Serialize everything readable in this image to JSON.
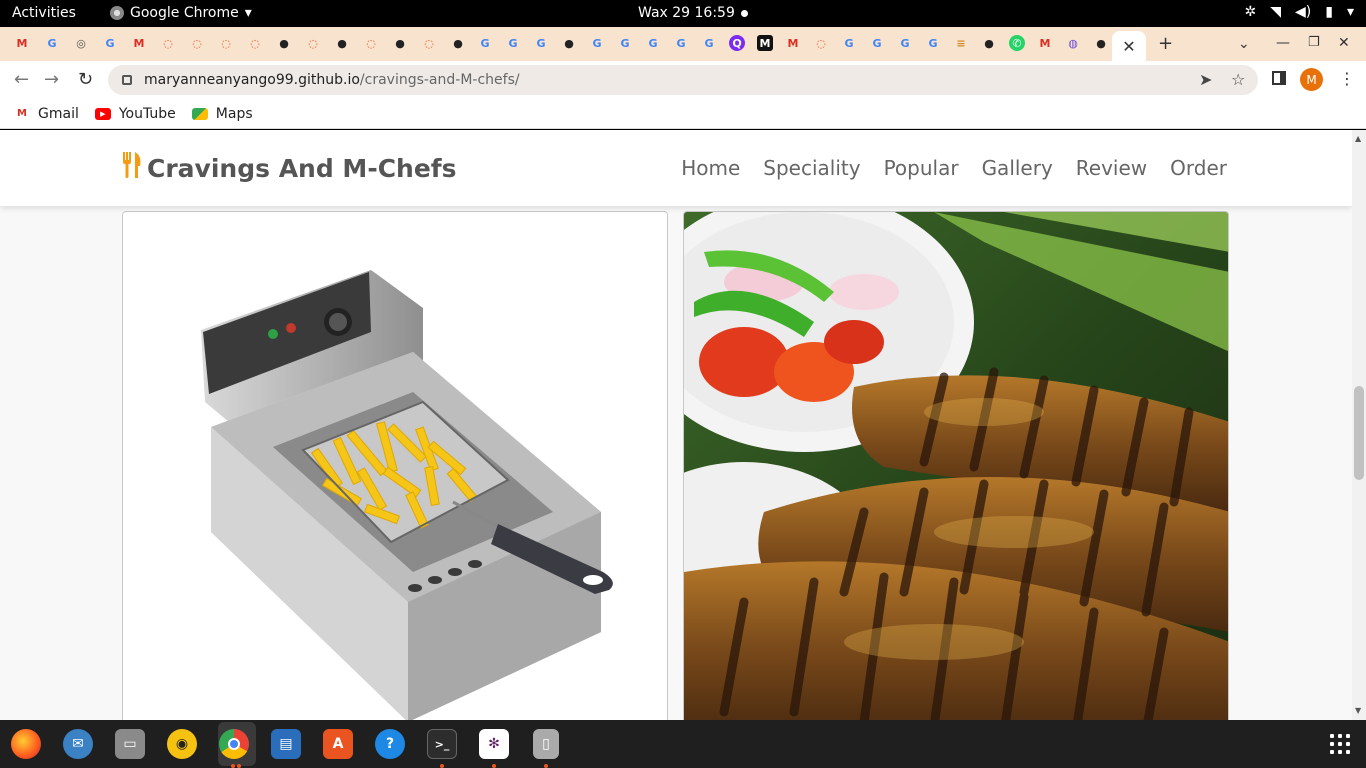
{
  "system_bar": {
    "activities": "Activities",
    "app_name": "Google Chrome",
    "clock": "Wax 29  16:59"
  },
  "browser": {
    "url_host": "maryanneanyango99.github.io",
    "url_path": "/cravings-and-M-chefs/",
    "avatar_initial": "M",
    "bookmarks": [
      {
        "label": "Gmail",
        "icon": "gmail-icon"
      },
      {
        "label": "YouTube",
        "icon": "youtube-icon"
      },
      {
        "label": "Maps",
        "icon": "maps-icon"
      }
    ]
  },
  "site": {
    "logo_text": "Cravings And M-Chefs",
    "nav": [
      "Home",
      "Speciality",
      "Popular",
      "Gallery",
      "Review",
      "Order"
    ]
  },
  "gallery": [
    {
      "name": "deep-fryer-with-fries-image"
    },
    {
      "name": "grilled-fish-with-salad-image"
    }
  ]
}
